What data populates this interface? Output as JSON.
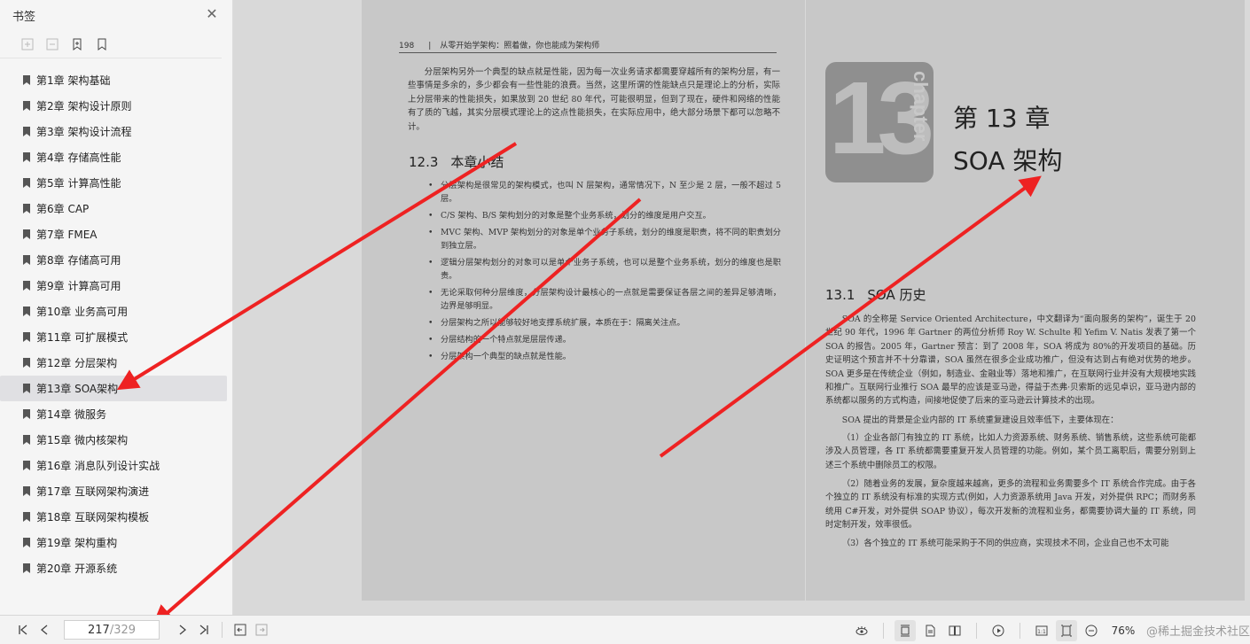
{
  "sidebar": {
    "title": "书签",
    "close_icon": "close-icon",
    "tools": [
      "expand-all-icon",
      "collapse-all-icon",
      "add-bookmark-icon",
      "bookmark-icon"
    ],
    "items": [
      {
        "label": "第1章 架构基础"
      },
      {
        "label": "第2章 架构设计原则"
      },
      {
        "label": "第3章 架构设计流程"
      },
      {
        "label": "第4章 存储高性能"
      },
      {
        "label": "第5章 计算高性能"
      },
      {
        "label": "第6章 CAP"
      },
      {
        "label": "第7章 FMEA"
      },
      {
        "label": "第8章 存储高可用"
      },
      {
        "label": "第9章 计算高可用"
      },
      {
        "label": "第10章 业务高可用"
      },
      {
        "label": "第11章 可扩展模式"
      },
      {
        "label": "第12章 分层架构"
      },
      {
        "label": "第13章 SOA架构",
        "active": true
      },
      {
        "label": "第14章 微服务"
      },
      {
        "label": "第15章 微内核架构"
      },
      {
        "label": "第16章 消息队列设计实战"
      },
      {
        "label": "第17章 互联网架构演进"
      },
      {
        "label": "第18章 互联网架构模板"
      },
      {
        "label": "第19章 架构重构"
      },
      {
        "label": "第20章 开源系统"
      }
    ]
  },
  "left_page": {
    "page_number": "198",
    "separator": "|",
    "running_title": "从零开始学架构：照着做，你也能成为架构师",
    "intro": "分层架构另外一个典型的缺点就是性能，因为每一次业务请求都需要穿越所有的架构分层，有一些事情是多余的，多少都会有一些性能的浪费。当然，这里所谓的性能缺点只是理论上的分析，实际上分层带来的性能损失，如果放到 20 世纪 80 年代，可能很明显，但到了现在，硬件和网络的性能有了质的飞越，其实分层模式理论上的这点性能损失，在实际应用中，绝大部分场景下都可以忽略不计。",
    "section_number": "12.3",
    "section_title": "本章小结",
    "bullets": [
      "分层架构是很常见的架构模式，也叫 N 层架构，通常情况下，N 至少是 2 层，一般不超过 5 层。",
      "C/S 架构、B/S 架构划分的对象是整个业务系统，划分的维度是用户交互。",
      "MVC 架构、MVP 架构划分的对象是单个业务子系统，划分的维度是职责，将不同的职责划分到独立层。",
      "逻辑分层架构划分的对象可以是单个业务子系统，也可以是整个业务系统，划分的维度也是职责。",
      "无论采取何种分层维度，分层架构设计最核心的一点就是需要保证各层之间的差异足够清晰，边界是够明显。",
      "分层架构之所以能够较好地支撑系统扩展，本质在于：隔离关注点。",
      "分层结构的一个特点就是层层传递。",
      "分层架构一个典型的缺点就是性能。"
    ]
  },
  "right_page": {
    "badge_number": "13",
    "badge_word": "chapter",
    "chapter_no": "第 13 章",
    "chapter_title": "SOA 架构",
    "section_number": "13.1",
    "section_title": "SOA 历史",
    "paragraphs": [
      "SOA 的全称是 Service Oriented Architecture，中文翻译为“面向服务的架构”，诞生于 20 世纪 90 年代，1996 年 Gartner 的两位分析师 Roy W. Schulte 和 Yefim V. Natis 发表了第一个 SOA 的报告。2005 年，Gartner 预言：到了 2008 年，SOA 将成为 80%的开发项目的基础。历史证明这个预言并不十分靠谱，SOA 虽然在很多企业成功推广，但没有达到占有绝对优势的地步。SOA 更多是在传统企业（例如，制造业、金融业等）落地和推广，在互联网行业并没有大规模地实践和推广。互联网行业推行 SOA 最早的应该是亚马逊，得益于杰弗·贝索斯的远见卓识，亚马逊内部的系统都以服务的方式构造，间接地促使了后来的亚马逊云计算技术的出现。",
      "SOA 提出的背景是企业内部的 IT 系统重复建设且效率低下，主要体现在：",
      "（1）企业各部门有独立的 IT 系统，比如人力资源系统、财务系统、销售系统，这些系统可能都涉及人员管理，各 IT 系统都需要重复开发人员管理的功能。例如，某个员工离职后，需要分别到上述三个系统中删除员工的权限。",
      "（2）随着业务的发展，复杂度越来越高，更多的流程和业务需要多个 IT 系统合作完成。由于各个独立的 IT 系统没有标准的实现方式(例如，人力资源系统用 Java 开发，对外提供 RPC；而财务系统用 C#开发，对外提供 SOAP 协议），每次开发新的流程和业务，都需要协调大量的 IT 系统，同时定制开发，效率很低。",
      "（3）各个独立的 IT 系统可能采购于不同的供应商，实现技术不同，企业自己也不太可能"
    ]
  },
  "toolbar": {
    "current_page": "217",
    "total_pages": "/329",
    "zoom": "76%",
    "watermark": "@稀土掘金技术社区"
  },
  "annotation_color": "#ee2222"
}
